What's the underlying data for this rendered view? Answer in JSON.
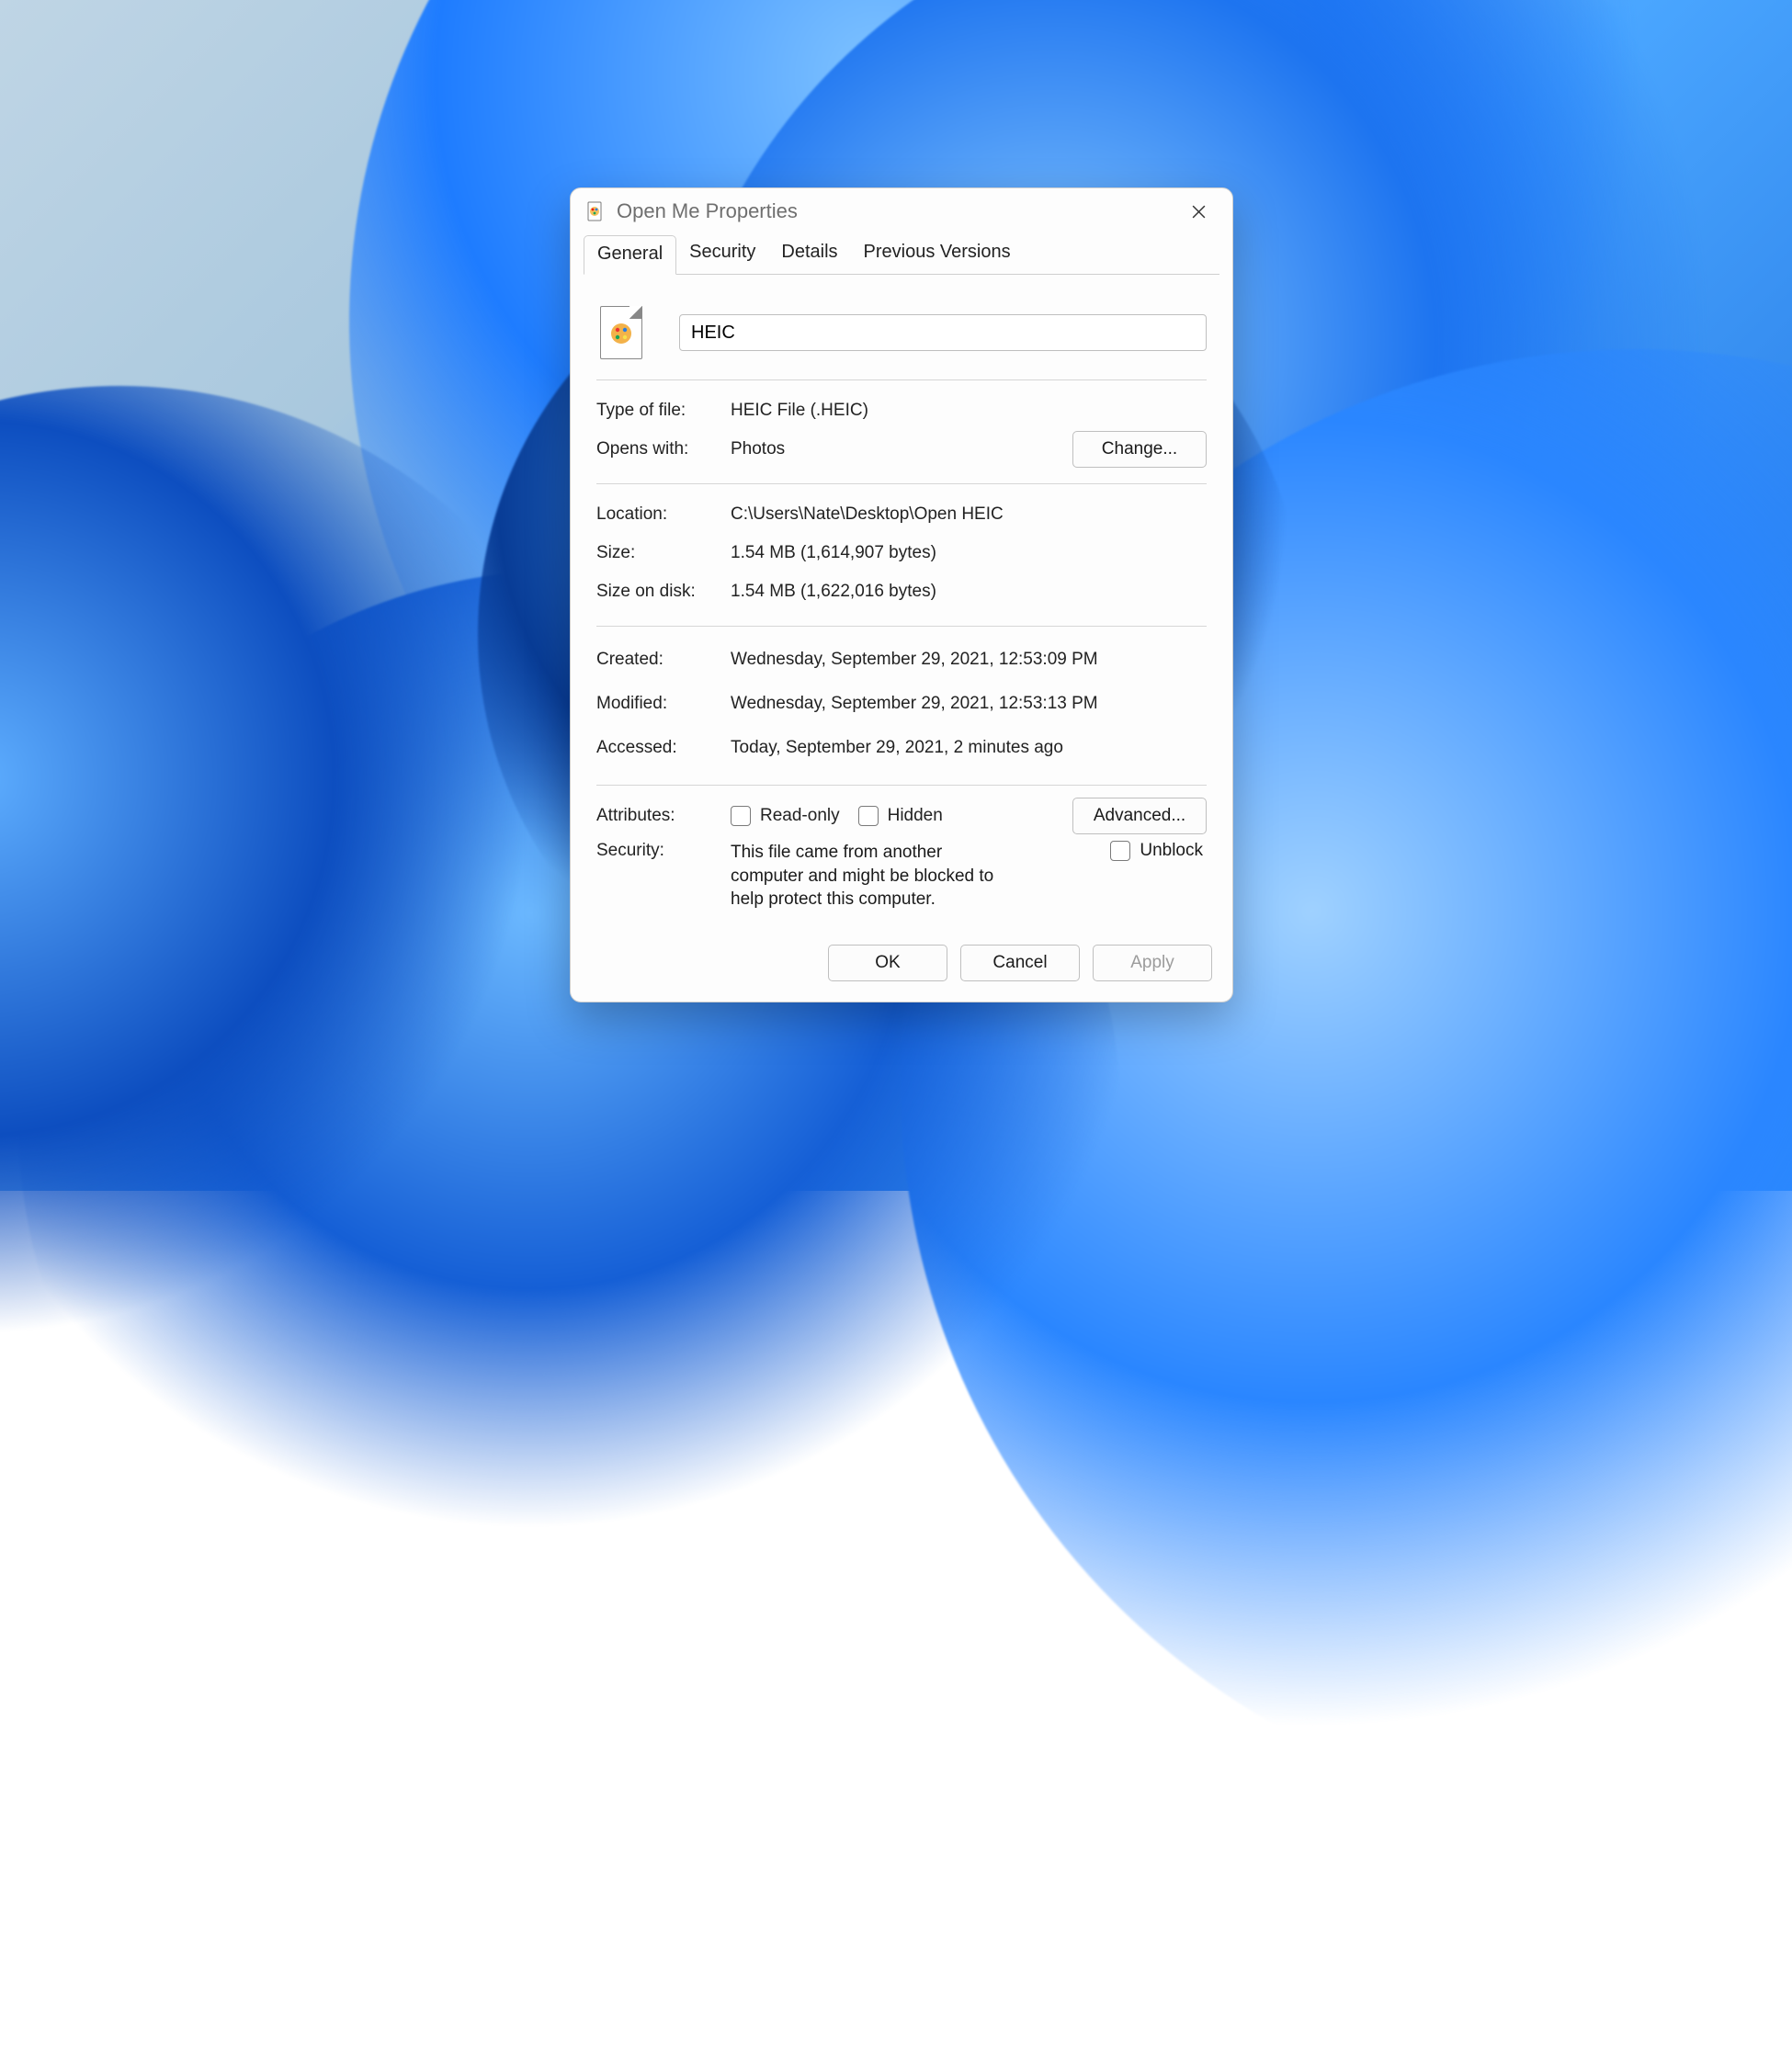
{
  "window": {
    "title": "Open Me Properties"
  },
  "tabs": [
    "General",
    "Security",
    "Details",
    "Previous Versions"
  ],
  "active_tab": 0,
  "file": {
    "name_value": "HEIC"
  },
  "labels": {
    "type": "Type of file:",
    "opens": "Opens with:",
    "location": "Location:",
    "size": "Size:",
    "disk": "Size on disk:",
    "created": "Created:",
    "modified": "Modified:",
    "accessed": "Accessed:",
    "attributes": "Attributes:",
    "security": "Security:"
  },
  "values": {
    "type": "HEIC File (.HEIC)",
    "opens": "Photos",
    "location": "C:\\Users\\Nate\\Desktop\\Open HEIC",
    "size": "1.54 MB (1,614,907 bytes)",
    "disk": "1.54 MB (1,622,016 bytes)",
    "created": "Wednesday, September 29, 2021, 12:53:09 PM",
    "modified": "Wednesday, September 29, 2021, 12:53:13 PM",
    "accessed": "Today, September 29, 2021, 2 minutes ago"
  },
  "buttons": {
    "change": "Change...",
    "advanced": "Advanced...",
    "ok": "OK",
    "cancel": "Cancel",
    "apply": "Apply"
  },
  "attributes": {
    "readonly_label": "Read-only",
    "hidden_label": "Hidden",
    "readonly_checked": false,
    "hidden_checked": false
  },
  "security": {
    "message": "This file came from another computer and might be blocked to help protect this computer.",
    "unblock_label": "Unblock",
    "unblock_checked": false
  }
}
